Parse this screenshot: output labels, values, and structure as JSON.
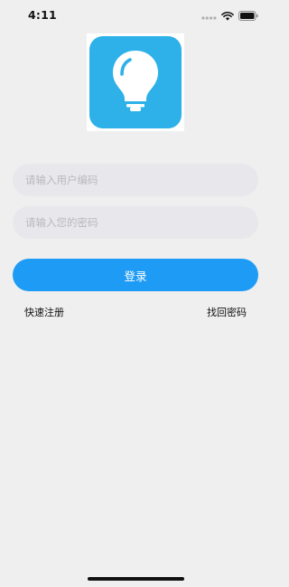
{
  "status_bar": {
    "time": "4:11",
    "icons": [
      "signal-dots-icon",
      "wifi-icon",
      "battery-icon"
    ]
  },
  "logo": {
    "icon": "lightbulb-icon",
    "colors": {
      "tile": "#2eb1e8",
      "bulb": "#ffffff"
    }
  },
  "form": {
    "user_placeholder": "请输入用户编码",
    "password_placeholder": "请输入您的密码",
    "login_label": "登录"
  },
  "links": {
    "register": "快速注册",
    "forgot_password": "找回密码"
  },
  "colors": {
    "background": "#efefef",
    "field": "#e8e8ec",
    "primary_button": "#1e9bf5"
  }
}
